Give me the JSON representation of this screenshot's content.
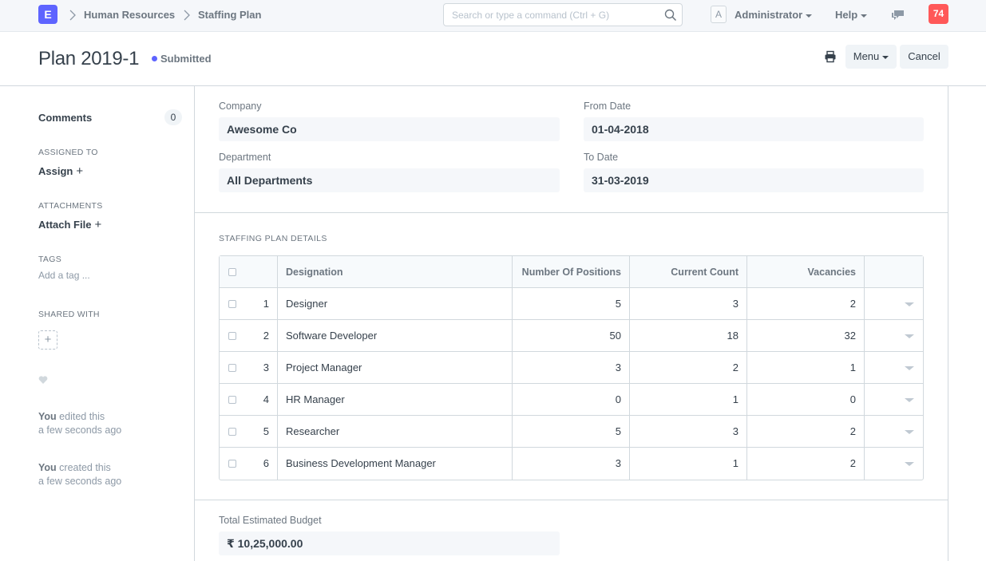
{
  "navbar": {
    "logo_letter": "E",
    "breadcrumbs": [
      "Human Resources",
      "Staffing Plan"
    ],
    "search_placeholder": "Search or type a command (Ctrl + G)",
    "avatar_letter": "A",
    "user_label": "Administrator",
    "help_label": "Help",
    "notification_count": "74"
  },
  "page": {
    "title": "Plan 2019-1",
    "status": "Submitted",
    "menu_label": "Menu",
    "cancel_label": "Cancel"
  },
  "sidebar": {
    "comments_label": "Comments",
    "comments_count": "0",
    "assigned_to_label": "ASSIGNED TO",
    "assign_label": "Assign",
    "attachments_label": "ATTACHMENTS",
    "attach_label": "Attach File",
    "tags_label": "TAGS",
    "add_tag_label": "Add a tag ...",
    "shared_with_label": "SHARED WITH",
    "timeline": [
      {
        "who": "You",
        "action": "edited this",
        "when": "a few seconds ago"
      },
      {
        "who": "You",
        "action": "created this",
        "when": "a few seconds ago"
      }
    ]
  },
  "form": {
    "company_label": "Company",
    "company_value": "Awesome Co",
    "from_date_label": "From Date",
    "from_date_value": "01-04-2018",
    "department_label": "Department",
    "department_value": "All Departments",
    "to_date_label": "To Date",
    "to_date_value": "31-03-2019",
    "details_section_title": "STAFFING PLAN DETAILS",
    "budget_label": "Total Estimated Budget",
    "budget_value": "₹ 10,25,000.00"
  },
  "table": {
    "headers": [
      "Designation",
      "Number Of Positions",
      "Current Count",
      "Vacancies"
    ],
    "rows": [
      {
        "idx": "1",
        "designation": "Designer",
        "positions": "5",
        "current": "3",
        "vacancies": "2"
      },
      {
        "idx": "2",
        "designation": "Software Developer",
        "positions": "50",
        "current": "18",
        "vacancies": "32"
      },
      {
        "idx": "3",
        "designation": "Project Manager",
        "positions": "3",
        "current": "2",
        "vacancies": "1"
      },
      {
        "idx": "4",
        "designation": "HR Manager",
        "positions": "0",
        "current": "1",
        "vacancies": "0"
      },
      {
        "idx": "5",
        "designation": "Researcher",
        "positions": "5",
        "current": "3",
        "vacancies": "2"
      },
      {
        "idx": "6",
        "designation": "Business Development Manager",
        "positions": "3",
        "current": "1",
        "vacancies": "2"
      }
    ]
  },
  "colors": {
    "brand": "#5e64ff",
    "notification": "#ff5858",
    "status_dot": "#5e64ff"
  }
}
